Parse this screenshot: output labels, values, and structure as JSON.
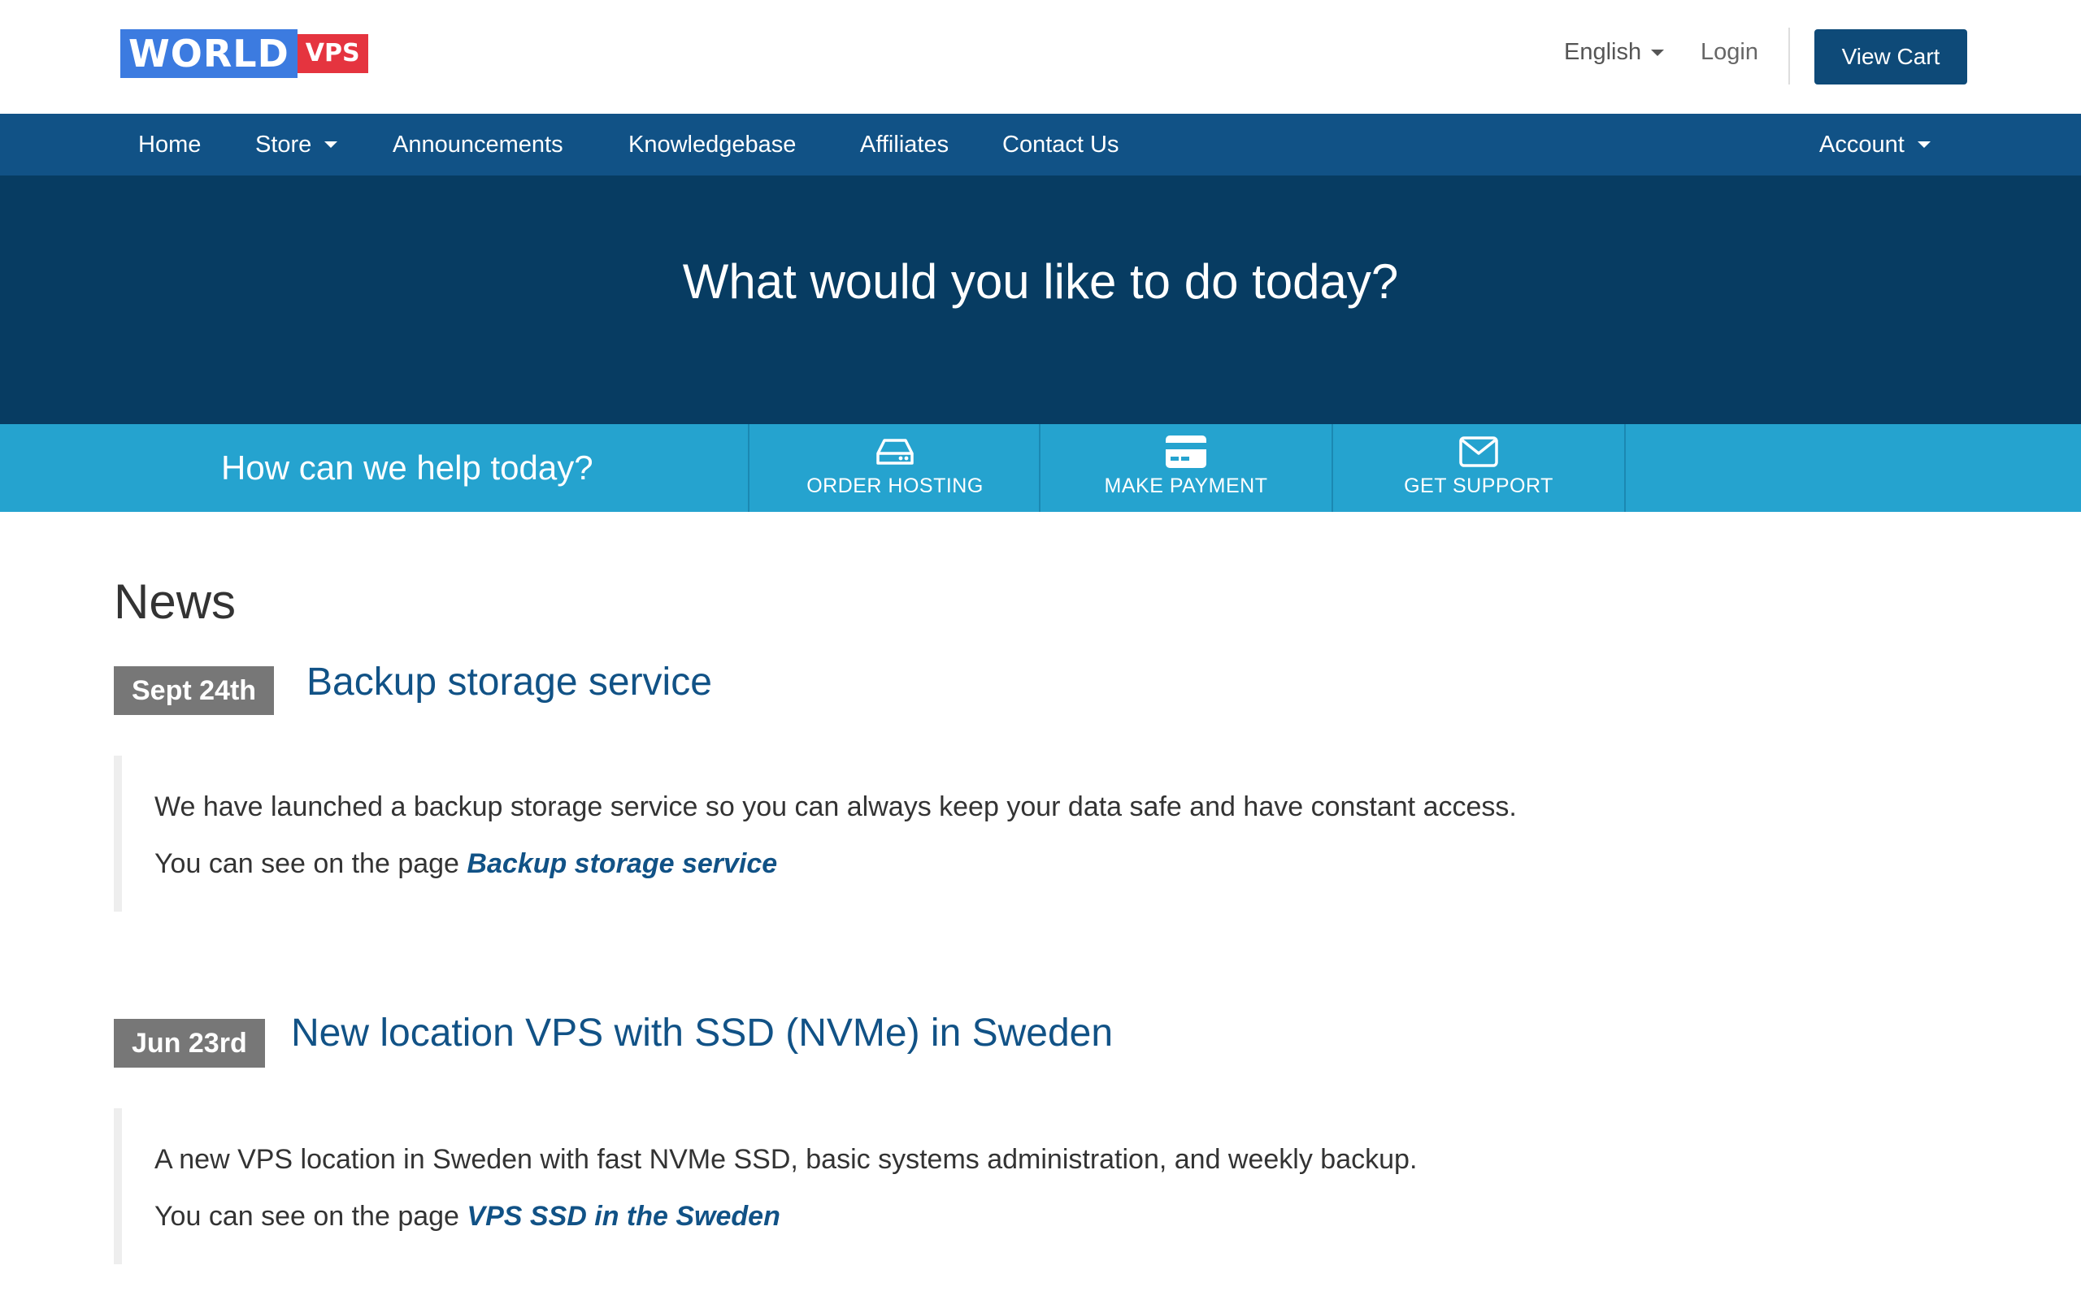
{
  "brand": {
    "logo_word": "WORLD",
    "logo_tag": "VPS",
    "colors": {
      "logo_word_bg": "#3c7be0",
      "logo_tag_bg": "#e5343f"
    }
  },
  "header": {
    "language": "English",
    "login": "Login",
    "view_cart": "View Cart"
  },
  "nav": {
    "items": [
      "Home",
      "Store",
      "Announcements",
      "Knowledgebase",
      "Affiliates",
      "Contact Us"
    ],
    "account": "Account"
  },
  "hero": {
    "title": "What would you like to do today?"
  },
  "help": {
    "prompt": "How can we help today?",
    "actions": [
      {
        "label": "ORDER HOSTING",
        "icon": "server-icon"
      },
      {
        "label": "MAKE PAYMENT",
        "icon": "credit-card-icon"
      },
      {
        "label": "GET SUPPORT",
        "icon": "envelope-icon"
      }
    ]
  },
  "news": {
    "heading": "News",
    "items": [
      {
        "date": "Sept 24th",
        "title": "Backup storage service",
        "body": "We have launched a backup storage service so you can always keep your data safe and have constant access.",
        "link_prefix": "You can see on the page",
        "link_text": "Backup storage service"
      },
      {
        "date": "Jun 23rd",
        "title": "New location VPS with SSD (NVMe) in Sweden",
        "body": "A new VPS location in Sweden with fast NVMe SSD, basic systems administration, and weekly backup.",
        "link_prefix": "You can see on the page",
        "link_text": "VPS SSD in the Sweden"
      }
    ]
  },
  "theme": {
    "nav_bg": "#115286",
    "hero_bg": "#073c62",
    "help_bg": "#25a3cf",
    "date_badge_bg": "#777777"
  }
}
